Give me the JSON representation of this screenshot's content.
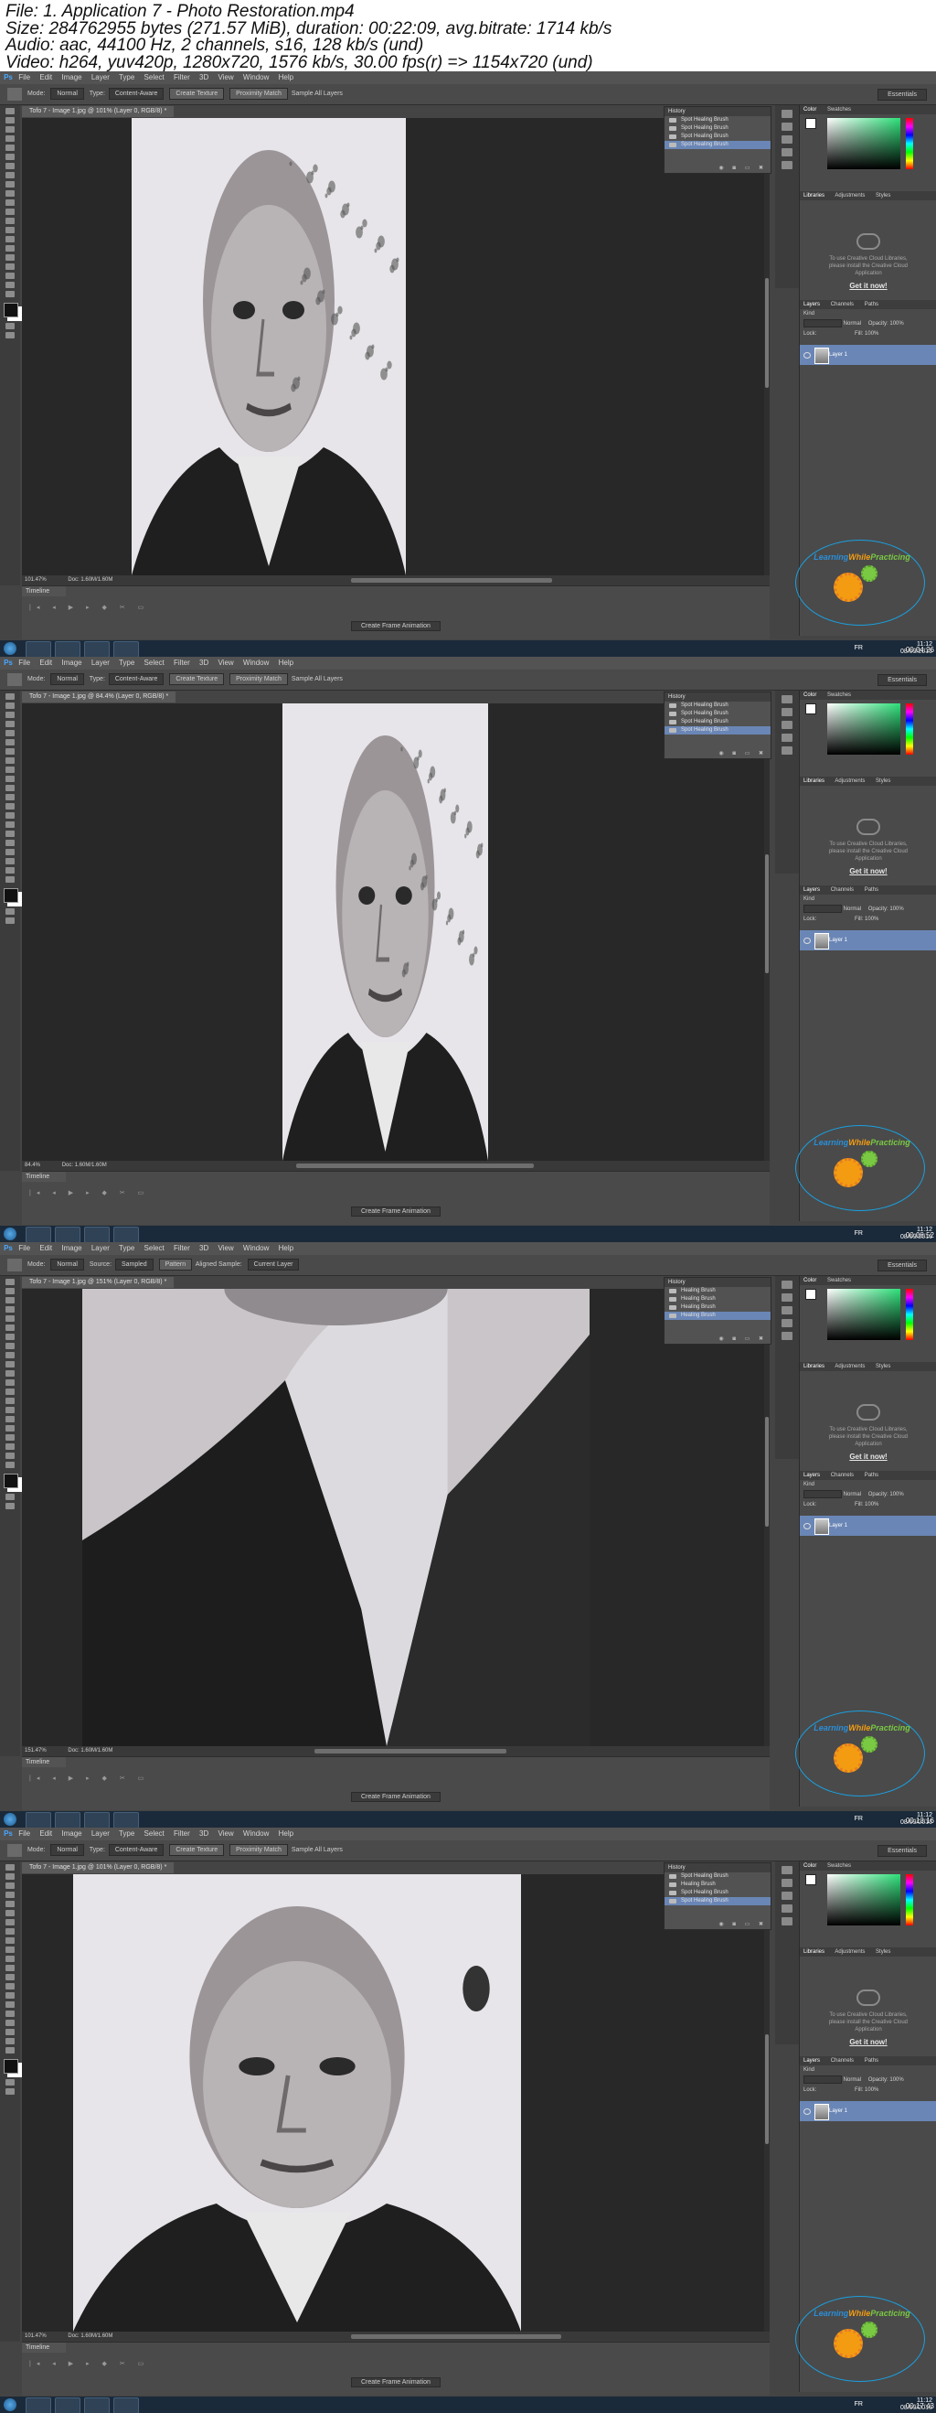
{
  "header": {
    "lines": [
      "File: 1. Application 7 - Photo Restoration.mp4",
      "Size: 284762955 bytes (271.57 MiB), duration: 00:22:09, avg.bitrate: 1714 kb/s",
      "Audio: aac, 44100 Hz, 2 channels, s16, 128 kb/s (und)",
      "Video: h264, yuv420p, 1280x720, 1576 kb/s, 30.00 fps(r) => 1154x720 (und)"
    ]
  },
  "menu": [
    "File",
    "Edit",
    "Image",
    "Layer",
    "Type",
    "Select",
    "Filter",
    "3D",
    "View",
    "Window",
    "Help"
  ],
  "ps_logo": "Ps",
  "workspace": "Essentials",
  "options_labels": {
    "mode": "Mode:",
    "mode_value": "Normal",
    "type": "Type:",
    "content_aware": "Content-Aware",
    "create_texture": "Create Texture",
    "proximity_match": "Proximity Match",
    "sample_all_layers": "Sample All Layers",
    "source": "Source:",
    "sampled": "Sampled",
    "pattern": "Pattern",
    "aligned": "Aligned",
    "sample": "Sample:",
    "current_layer": "Current Layer"
  },
  "panels": {
    "history": "History",
    "color_tab": "Color",
    "swatches_tab": "Swatches",
    "libraries_tab": "Libraries",
    "adjustments_tab": "Adjustments",
    "styles_tab": "Styles",
    "cc_message_1": "To use Creative Cloud Libraries,",
    "cc_message_2": "please install the Creative Cloud",
    "cc_message_3": "Application",
    "get_it_now": "Get it now!",
    "layers_tab": "Layers",
    "channels_tab": "Channels",
    "paths_tab": "Paths",
    "kind": "Kind",
    "normal": "Normal",
    "opacity": "Opacity:",
    "opacity_value": "100%",
    "lock": "Lock:",
    "fill": "Fill:",
    "fill_value": "100%",
    "layer_name": "Layer 1"
  },
  "timeline": {
    "title": "Timeline",
    "create_frame_animation": "Create Frame Animation"
  },
  "logo": {
    "part1": "Learning",
    "part2": "While",
    "part3": "Practicing"
  },
  "taskbar": {
    "lang": "FR",
    "time": "11:12",
    "date": "08/09/2016"
  },
  "frames": [
    {
      "doc_tab": "Tofo 7 - Image 1.jpg @ 101% (Layer 0, RGB/8) *",
      "zoom": "101.47%",
      "doc_size": "Doc: 1.60M/1.60M",
      "timestamp": "00:04:26",
      "history_items": [
        "Spot Healing Brush",
        "Spot Healing Brush",
        "Spot Healing Brush",
        "Spot Healing Brush"
      ],
      "tool": "spot-healing"
    },
    {
      "doc_tab": "Tofo 7 - Image 1.jpg @ 84.4% (Layer 0, RGB/8) *",
      "zoom": "84.4%",
      "doc_size": "Doc: 1.60M/1.60M",
      "timestamp": "00:08:52",
      "history_items": [
        "Spot Healing Brush",
        "Spot Healing Brush",
        "Spot Healing Brush",
        "Spot Healing Brush"
      ],
      "tool": "spot-healing"
    },
    {
      "doc_tab": "Tofo 7 - Image 1.jpg @ 151% (Layer 0, RGB/8) *",
      "zoom": "151.47%",
      "doc_size": "Doc: 1.60M/1.60M",
      "timestamp": "00:13:16",
      "history_items": [
        "Healing Brush",
        "Healing Brush",
        "Healing Brush",
        "Healing Brush"
      ],
      "tool": "healing"
    },
    {
      "doc_tab": "Tofo 7 - Image 1.jpg @ 101% (Layer 0, RGB/8) *",
      "zoom": "101.47%",
      "doc_size": "Doc: 1.60M/1.60M",
      "timestamp": "00:17:43",
      "history_items": [
        "Spot Healing Brush",
        "Healing Brush",
        "Spot Healing Brush",
        "Spot Healing Brush"
      ],
      "tool": "spot-healing"
    }
  ]
}
